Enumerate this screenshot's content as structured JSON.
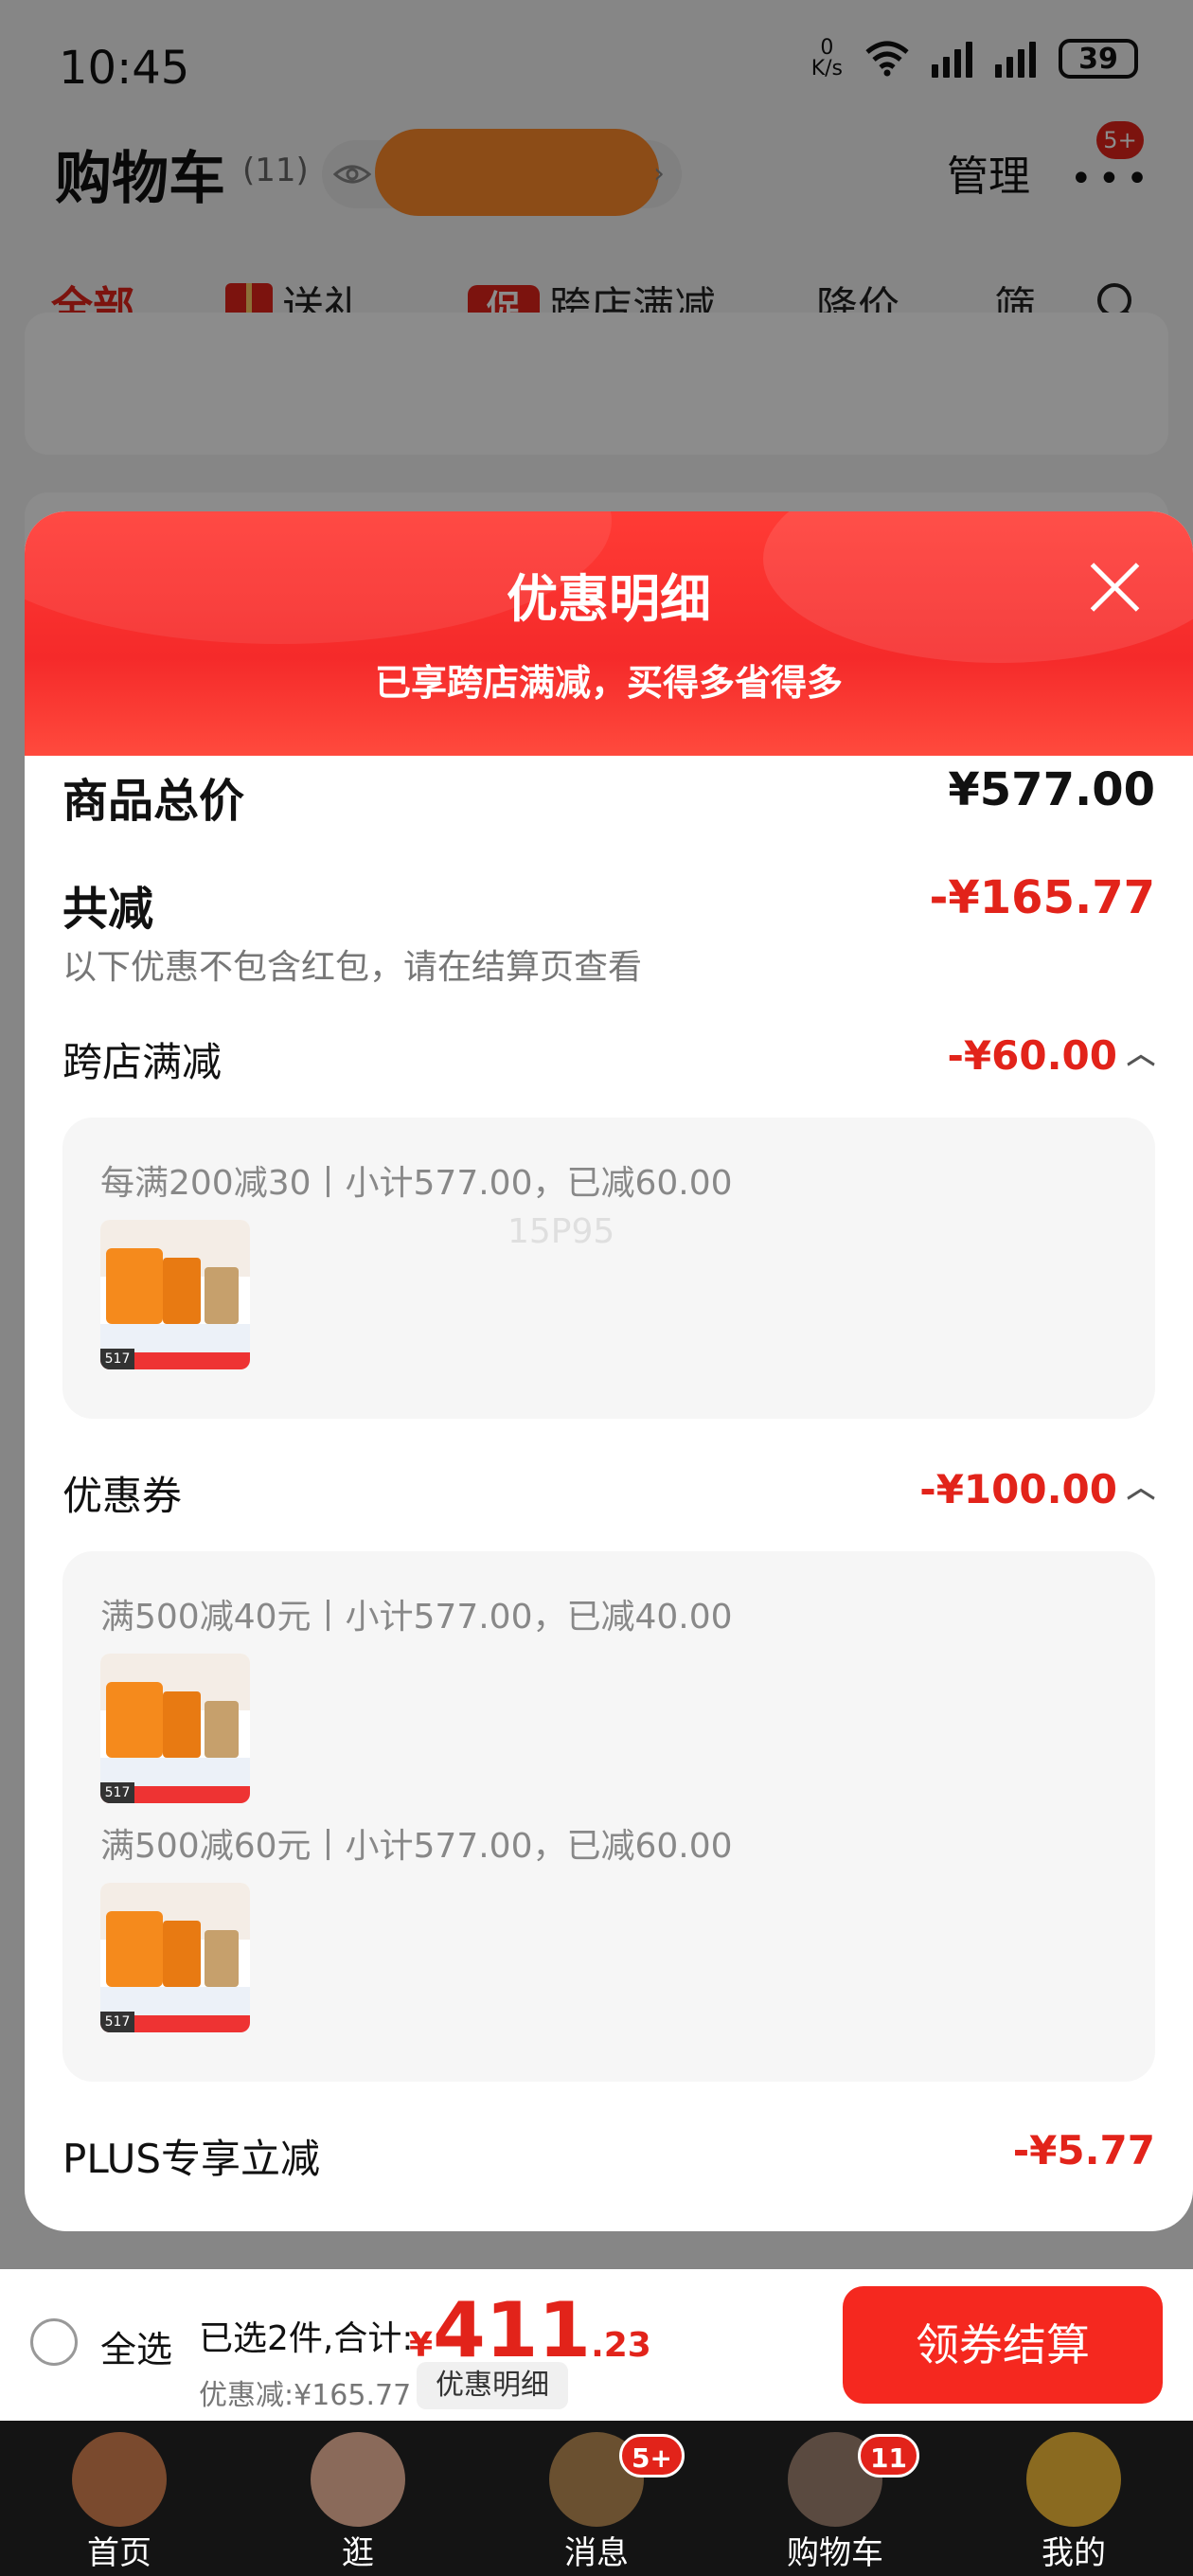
{
  "status": {
    "time": "10:45",
    "netspeed_value": "0",
    "netspeed_unit": "K/s",
    "battery": "39"
  },
  "header": {
    "title": "购物车",
    "count": "(11)",
    "manage": "管理",
    "more_badge": "5+"
  },
  "tabs": [
    {
      "label": "全部"
    },
    {
      "label": "送礼"
    },
    {
      "label": "跨店满减",
      "icon_text": "促"
    },
    {
      "label": "降价"
    },
    {
      "label": "筛"
    }
  ],
  "sheet": {
    "title": "优惠明细",
    "subtitle": "已享跨店满减，买得多省得多",
    "total_label": "商品总价",
    "total_value": "¥577.00",
    "reduce_label": "共减",
    "reduce_value": "-¥165.77",
    "note": "以下优惠不包含红包，请在结算页查看",
    "sections": [
      {
        "label": "跨店满减",
        "value": "-¥60.00",
        "lines": [
          "每满200减30丨小计577.00，已减60.00"
        ]
      },
      {
        "label": "优惠券",
        "value": "-¥100.00",
        "lines": [
          "满500减40元丨小计577.00，已减40.00",
          "满500减60元丨小计577.00，已减60.00"
        ]
      }
    ],
    "plus_label": "PLUS专享立减",
    "plus_value": "-¥5.77",
    "watermark": "15P95",
    "thumb_tag": "517"
  },
  "checkout": {
    "select_all": "全选",
    "selected": "已选2件,合计:",
    "currency": "¥",
    "total_int": "411",
    "total_dec": ".23",
    "discount": "优惠减:¥165.77",
    "detail_btn": "优惠明细",
    "submit": "领券结算"
  },
  "nav": [
    {
      "label": "首页",
      "icon": "home-avatar-icon",
      "color": "#7a4a2e"
    },
    {
      "label": "逛",
      "icon": "browse-avatar-icon",
      "color": "#8a6a5a"
    },
    {
      "label": "消息",
      "icon": "messages-avatar-icon",
      "color": "#6a5030",
      "badge": "5+"
    },
    {
      "label": "购物车",
      "icon": "cart-avatar-icon",
      "color": "#5a4a40",
      "badge": "11"
    },
    {
      "label": "我的",
      "icon": "profile-avatar-icon",
      "color": "#8a6a20"
    }
  ],
  "colors": {
    "accent": "#e2231a",
    "header_red": "#f52a2a"
  }
}
